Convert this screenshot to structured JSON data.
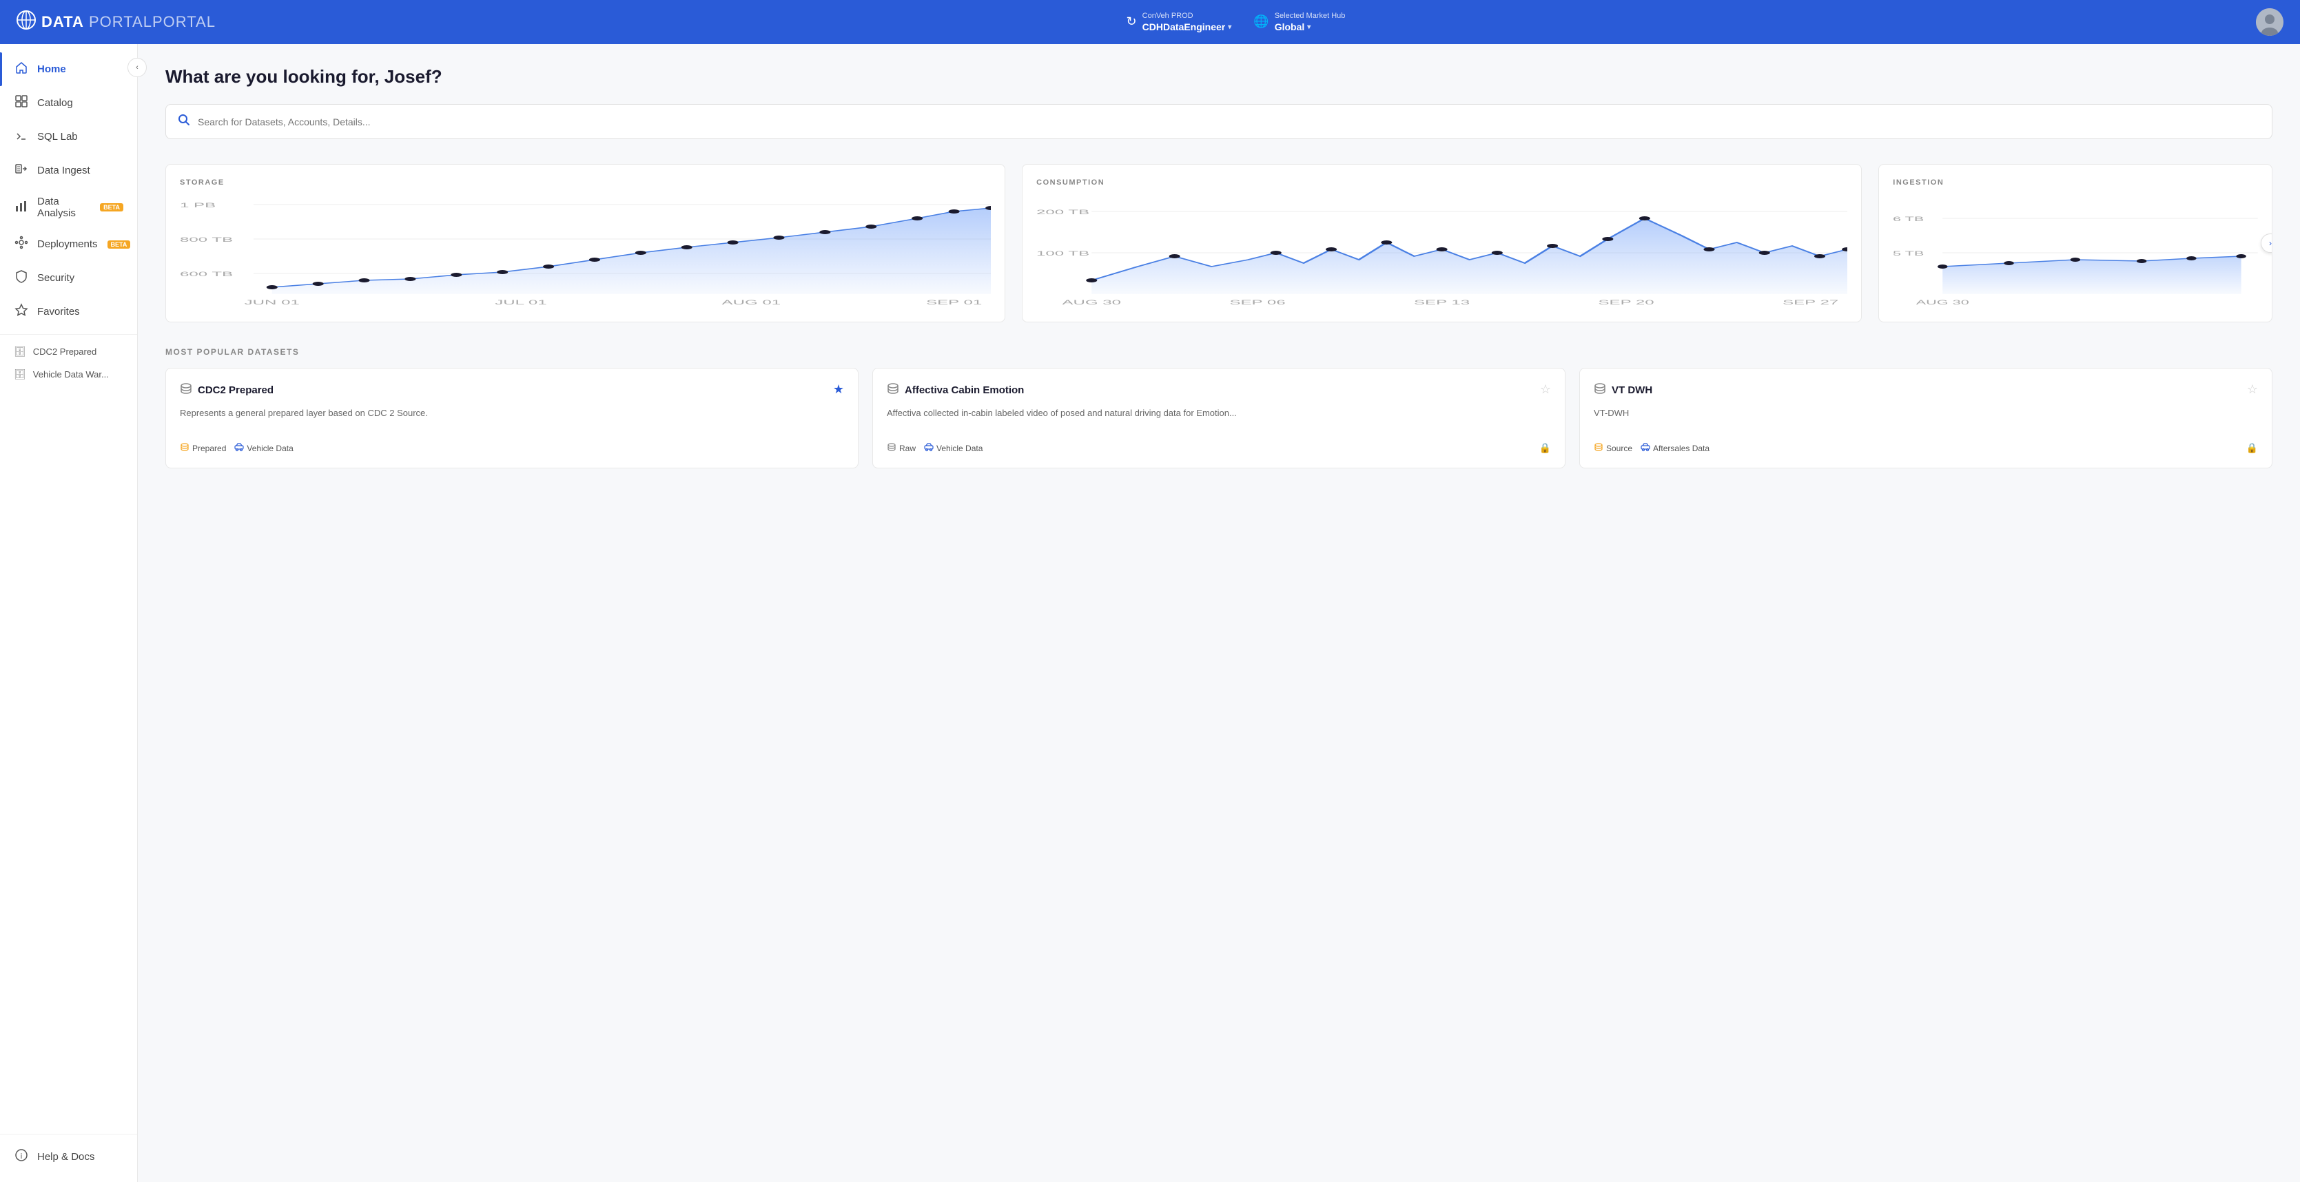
{
  "header": {
    "logo_icon": "⊕",
    "logo_data": "DATA",
    "logo_portal": "PORTAL",
    "env_label": "ConVeh PROD",
    "env_value": "CDHDataEngineer",
    "market_label": "Selected Market Hub",
    "market_value": "Global"
  },
  "sidebar": {
    "collapse_icon": "‹",
    "items": [
      {
        "id": "home",
        "label": "Home",
        "icon": "🏠",
        "active": true,
        "beta": false
      },
      {
        "id": "catalog",
        "label": "Catalog",
        "icon": "▦",
        "active": false,
        "beta": false
      },
      {
        "id": "sqllab",
        "label": "SQL Lab",
        "icon": "⌕",
        "active": false,
        "beta": false
      },
      {
        "id": "data-ingest",
        "label": "Data Ingest",
        "icon": "→▤",
        "active": false,
        "beta": false
      },
      {
        "id": "data-analysis",
        "label": "Data Analysis",
        "icon": "📊",
        "active": false,
        "beta": true
      },
      {
        "id": "deployments",
        "label": "Deployments",
        "icon": "✦",
        "active": false,
        "beta": true
      },
      {
        "id": "security",
        "label": "Security",
        "icon": "🛡",
        "active": false,
        "beta": false
      },
      {
        "id": "favorites",
        "label": "Favorites",
        "icon": "☆",
        "active": false,
        "beta": false
      }
    ],
    "sub_items": [
      {
        "id": "cdc2",
        "label": "CDC2 Prepared",
        "icon": "🗄"
      },
      {
        "id": "vehicle",
        "label": "Vehicle Data War...",
        "icon": "🗄"
      }
    ],
    "bottom_items": [
      {
        "id": "help",
        "label": "Help & Docs",
        "icon": "ℹ"
      }
    ]
  },
  "main": {
    "greeting": "What are you looking for, Josef?",
    "search_placeholder": "Search for Datasets, Accounts, Details..."
  },
  "charts": {
    "storage": {
      "title": "STORAGE",
      "y_labels": [
        "1 PB",
        "800 TB",
        "600 TB"
      ],
      "x_labels": [
        "JUN 01",
        "JUL 01",
        "AUG 01",
        "SEP 01"
      ],
      "data": [
        15,
        18,
        22,
        25,
        28,
        30,
        35,
        42,
        50,
        55,
        60,
        65,
        70,
        75,
        80,
        85,
        92,
        95
      ]
    },
    "consumption": {
      "title": "CONSUMPTION",
      "y_labels": [
        "200 TB",
        "100 TB"
      ],
      "x_labels": [
        "AUG 30",
        "SEP 06",
        "SEP 13",
        "SEP 20",
        "SEP 27"
      ],
      "data": [
        30,
        45,
        55,
        40,
        50,
        60,
        45,
        55,
        65,
        50,
        70,
        80,
        60,
        50,
        55,
        65,
        90,
        70,
        60,
        55
      ]
    },
    "ingestion": {
      "title": "INGESTION",
      "y_labels": [
        "6 TB",
        "5 TB"
      ],
      "x_labels": [
        "AUG 30"
      ],
      "data": [
        40,
        42,
        44,
        43,
        45,
        44
      ]
    }
  },
  "datasets": {
    "section_title": "MOST POPULAR DATASETS",
    "items": [
      {
        "id": "cdc2",
        "icon": "🗄",
        "name": "CDC2 Prepared",
        "starred": true,
        "desc": "Represents a general prepared layer based on CDC 2 Source.",
        "tags": [
          {
            "icon": "🗄",
            "label": "Prepared"
          },
          {
            "icon": "🚗",
            "label": "Vehicle Data"
          }
        ],
        "locked": false
      },
      {
        "id": "affectiva",
        "icon": "🗄",
        "name": "Affectiva Cabin Emotion",
        "starred": false,
        "desc": "Affectiva collected in-cabin labeled video of posed and natural driving data for Emotion...",
        "tags": [
          {
            "icon": "🗄",
            "label": "Raw"
          },
          {
            "icon": "🚗",
            "label": "Vehicle Data"
          }
        ],
        "locked": true
      },
      {
        "id": "vtdwh",
        "icon": "🗄",
        "name": "VT DWH",
        "starred": false,
        "desc": "VT-DWH",
        "tags": [
          {
            "icon": "🗄",
            "label": "Source"
          },
          {
            "icon": "🚗",
            "label": "Aftersales Data"
          }
        ],
        "locked": true
      }
    ]
  }
}
